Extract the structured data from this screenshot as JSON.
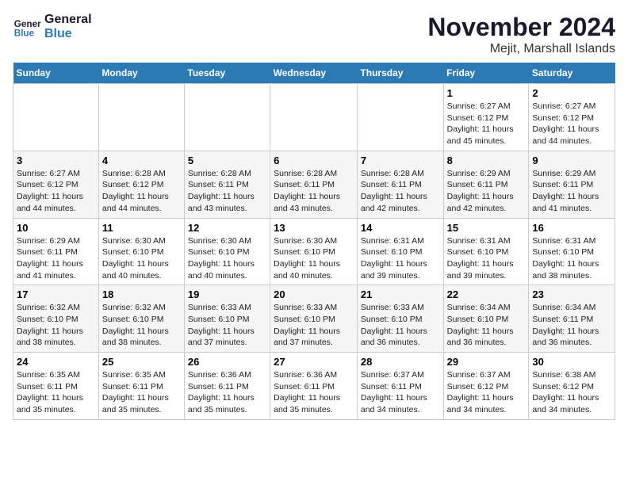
{
  "header": {
    "logo_line1": "General",
    "logo_line2": "Blue",
    "month": "November 2024",
    "location": "Mejit, Marshall Islands"
  },
  "weekdays": [
    "Sunday",
    "Monday",
    "Tuesday",
    "Wednesday",
    "Thursday",
    "Friday",
    "Saturday"
  ],
  "weeks": [
    [
      {
        "day": "",
        "info": ""
      },
      {
        "day": "",
        "info": ""
      },
      {
        "day": "",
        "info": ""
      },
      {
        "day": "",
        "info": ""
      },
      {
        "day": "",
        "info": ""
      },
      {
        "day": "1",
        "info": "Sunrise: 6:27 AM\nSunset: 6:12 PM\nDaylight: 11 hours and 45 minutes."
      },
      {
        "day": "2",
        "info": "Sunrise: 6:27 AM\nSunset: 6:12 PM\nDaylight: 11 hours and 44 minutes."
      }
    ],
    [
      {
        "day": "3",
        "info": "Sunrise: 6:27 AM\nSunset: 6:12 PM\nDaylight: 11 hours and 44 minutes."
      },
      {
        "day": "4",
        "info": "Sunrise: 6:28 AM\nSunset: 6:12 PM\nDaylight: 11 hours and 44 minutes."
      },
      {
        "day": "5",
        "info": "Sunrise: 6:28 AM\nSunset: 6:11 PM\nDaylight: 11 hours and 43 minutes."
      },
      {
        "day": "6",
        "info": "Sunrise: 6:28 AM\nSunset: 6:11 PM\nDaylight: 11 hours and 43 minutes."
      },
      {
        "day": "7",
        "info": "Sunrise: 6:28 AM\nSunset: 6:11 PM\nDaylight: 11 hours and 42 minutes."
      },
      {
        "day": "8",
        "info": "Sunrise: 6:29 AM\nSunset: 6:11 PM\nDaylight: 11 hours and 42 minutes."
      },
      {
        "day": "9",
        "info": "Sunrise: 6:29 AM\nSunset: 6:11 PM\nDaylight: 11 hours and 41 minutes."
      }
    ],
    [
      {
        "day": "10",
        "info": "Sunrise: 6:29 AM\nSunset: 6:11 PM\nDaylight: 11 hours and 41 minutes."
      },
      {
        "day": "11",
        "info": "Sunrise: 6:30 AM\nSunset: 6:10 PM\nDaylight: 11 hours and 40 minutes."
      },
      {
        "day": "12",
        "info": "Sunrise: 6:30 AM\nSunset: 6:10 PM\nDaylight: 11 hours and 40 minutes."
      },
      {
        "day": "13",
        "info": "Sunrise: 6:30 AM\nSunset: 6:10 PM\nDaylight: 11 hours and 40 minutes."
      },
      {
        "day": "14",
        "info": "Sunrise: 6:31 AM\nSunset: 6:10 PM\nDaylight: 11 hours and 39 minutes."
      },
      {
        "day": "15",
        "info": "Sunrise: 6:31 AM\nSunset: 6:10 PM\nDaylight: 11 hours and 39 minutes."
      },
      {
        "day": "16",
        "info": "Sunrise: 6:31 AM\nSunset: 6:10 PM\nDaylight: 11 hours and 38 minutes."
      }
    ],
    [
      {
        "day": "17",
        "info": "Sunrise: 6:32 AM\nSunset: 6:10 PM\nDaylight: 11 hours and 38 minutes."
      },
      {
        "day": "18",
        "info": "Sunrise: 6:32 AM\nSunset: 6:10 PM\nDaylight: 11 hours and 38 minutes."
      },
      {
        "day": "19",
        "info": "Sunrise: 6:33 AM\nSunset: 6:10 PM\nDaylight: 11 hours and 37 minutes."
      },
      {
        "day": "20",
        "info": "Sunrise: 6:33 AM\nSunset: 6:10 PM\nDaylight: 11 hours and 37 minutes."
      },
      {
        "day": "21",
        "info": "Sunrise: 6:33 AM\nSunset: 6:10 PM\nDaylight: 11 hours and 36 minutes."
      },
      {
        "day": "22",
        "info": "Sunrise: 6:34 AM\nSunset: 6:10 PM\nDaylight: 11 hours and 36 minutes."
      },
      {
        "day": "23",
        "info": "Sunrise: 6:34 AM\nSunset: 6:11 PM\nDaylight: 11 hours and 36 minutes."
      }
    ],
    [
      {
        "day": "24",
        "info": "Sunrise: 6:35 AM\nSunset: 6:11 PM\nDaylight: 11 hours and 35 minutes."
      },
      {
        "day": "25",
        "info": "Sunrise: 6:35 AM\nSunset: 6:11 PM\nDaylight: 11 hours and 35 minutes."
      },
      {
        "day": "26",
        "info": "Sunrise: 6:36 AM\nSunset: 6:11 PM\nDaylight: 11 hours and 35 minutes."
      },
      {
        "day": "27",
        "info": "Sunrise: 6:36 AM\nSunset: 6:11 PM\nDaylight: 11 hours and 35 minutes."
      },
      {
        "day": "28",
        "info": "Sunrise: 6:37 AM\nSunset: 6:11 PM\nDaylight: 11 hours and 34 minutes."
      },
      {
        "day": "29",
        "info": "Sunrise: 6:37 AM\nSunset: 6:12 PM\nDaylight: 11 hours and 34 minutes."
      },
      {
        "day": "30",
        "info": "Sunrise: 6:38 AM\nSunset: 6:12 PM\nDaylight: 11 hours and 34 minutes."
      }
    ]
  ]
}
